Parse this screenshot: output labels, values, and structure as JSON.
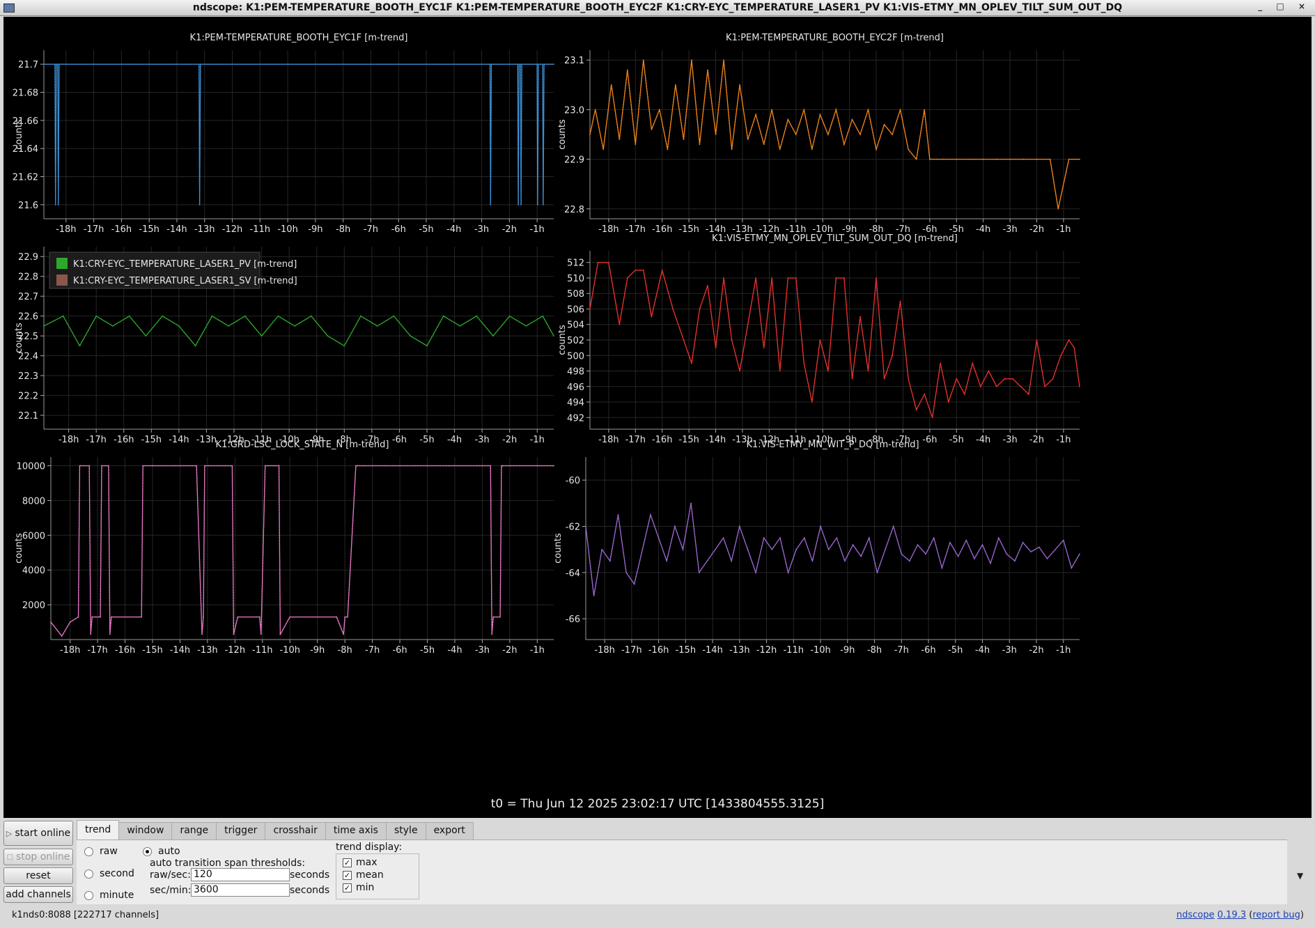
{
  "window": {
    "title": "ndscope: K1:PEM-TEMPERATURE_BOOTH_EYC1F K1:PEM-TEMPERATURE_BOOTH_EYC2F K1:CRY-EYC_TEMPERATURE_LASER1_PV K1:VIS-ETMY_MN_OPLEV_TILT_SUM_OUT_DQ",
    "icon": "app-window-icon",
    "controls": "_ □ ×"
  },
  "plots": {
    "t0": "t0 = Thu Jun 12 2025 23:02:17 UTC [1433804555.3125]"
  },
  "chart_data": [
    {
      "type": "line",
      "title": "K1:PEM-TEMPERATURE_BOOTH_EYC1F [m-trend]",
      "ylabel": "counts",
      "xticks": [
        "-18h",
        "-17h",
        "-16h",
        "-15h",
        "-14h",
        "-13h",
        "-12h",
        "-11h",
        "-10h",
        "-9h",
        "-8h",
        "-7h",
        "-6h",
        "-5h",
        "-4h",
        "-3h",
        "-2h",
        "-1h"
      ],
      "yticks": [
        "21.6",
        "21.62",
        "21.64",
        "21.66",
        "21.68",
        "21.7"
      ],
      "xlim": [
        -18.8,
        -0.4
      ],
      "ylim": [
        21.59,
        21.71
      ],
      "color": "#3b8fd4",
      "series": [
        {
          "x": [
            -18.8,
            -18.4,
            -18.38,
            -18.35,
            -18.3,
            -18.28,
            -18.25,
            -13.2,
            -13.18,
            -13.15,
            -2.7,
            -2.68,
            -2.65,
            -1.7,
            -1.68,
            -1.65,
            -1.6,
            -1.58,
            -1.55,
            -1.0,
            -0.98,
            -0.95,
            -0.8,
            -0.78,
            -0.75,
            -0.6,
            -0.4
          ],
          "y": [
            21.7,
            21.7,
            21.6,
            21.7,
            21.7,
            21.6,
            21.7,
            21.7,
            21.6,
            21.7,
            21.7,
            21.6,
            21.7,
            21.7,
            21.6,
            21.7,
            21.7,
            21.6,
            21.7,
            21.7,
            21.6,
            21.7,
            21.7,
            21.6,
            21.7,
            21.7,
            21.7
          ]
        }
      ]
    },
    {
      "type": "line",
      "title": "K1:PEM-TEMPERATURE_BOOTH_EYC2F [m-trend]",
      "ylabel": "counts",
      "xticks": [
        "-18h",
        "-17h",
        "-16h",
        "-15h",
        "-14h",
        "-13h",
        "-12h",
        "-11h",
        "-10h",
        "-9h",
        "-8h",
        "-7h",
        "-6h",
        "-5h",
        "-4h",
        "-3h",
        "-2h",
        "-1h"
      ],
      "yticks": [
        "22.8",
        "22.9",
        "23.0",
        "23.1"
      ],
      "xlim": [
        -18.7,
        -0.4
      ],
      "ylim": [
        22.78,
        23.12
      ],
      "color": "#f0841a",
      "series": [
        {
          "x": [
            -18.7,
            -18.5,
            -18.2,
            -17.9,
            -17.6,
            -17.3,
            -17.0,
            -16.7,
            -16.4,
            -16.1,
            -15.8,
            -15.5,
            -15.2,
            -14.9,
            -14.6,
            -14.3,
            -14.0,
            -13.7,
            -13.4,
            -13.1,
            -12.8,
            -12.5,
            -12.2,
            -11.9,
            -11.6,
            -11.3,
            -11.0,
            -10.7,
            -10.4,
            -10.1,
            -9.8,
            -9.5,
            -9.2,
            -8.9,
            -8.6,
            -8.3,
            -8.0,
            -7.7,
            -7.4,
            -7.1,
            -6.8,
            -6.5,
            -6.2,
            -6.0,
            -5.5,
            -5.0,
            -4.5,
            -4.0,
            -3.5,
            -3.0,
            -2.5,
            -2.0,
            -1.5,
            -1.2,
            -0.8,
            -0.4
          ],
          "y": [
            22.95,
            23.0,
            22.92,
            23.05,
            22.94,
            23.08,
            22.93,
            23.1,
            22.96,
            23.0,
            22.92,
            23.05,
            22.94,
            23.1,
            22.93,
            23.08,
            22.95,
            23.1,
            22.92,
            23.05,
            22.94,
            22.99,
            22.93,
            23.0,
            22.92,
            22.98,
            22.95,
            23.0,
            22.92,
            22.99,
            22.95,
            23.0,
            22.93,
            22.98,
            22.95,
            23.0,
            22.92,
            22.97,
            22.95,
            23.0,
            22.92,
            22.9,
            23.0,
            22.9,
            22.9,
            22.9,
            22.9,
            22.9,
            22.9,
            22.9,
            22.9,
            22.9,
            22.9,
            22.8,
            22.9,
            22.9
          ]
        }
      ]
    },
    {
      "type": "line",
      "title": "",
      "ylabel": "counts",
      "xticks": [
        "-18h",
        "-17h",
        "-16h",
        "-15h",
        "-14h",
        "-13h",
        "-12h",
        "-11h",
        "-10h",
        "-9h",
        "-8h",
        "-7h",
        "-6h",
        "-5h",
        "-4h",
        "-3h",
        "-2h",
        "-1h"
      ],
      "yticks": [
        "22.1",
        "22.2",
        "22.3",
        "22.4",
        "22.5",
        "22.6",
        "22.7",
        "22.8",
        "22.9"
      ],
      "xlim": [
        -18.9,
        -0.4
      ],
      "ylim": [
        22.03,
        22.95
      ],
      "legend": [
        "K1:CRY-EYC_TEMPERATURE_LASER1_PV [m-trend]",
        "K1:CRY-EYC_TEMPERATURE_LASER1_SV [m-trend]"
      ],
      "legend_colors": [
        "#2ca82c",
        "#8c564b"
      ],
      "color": "#2ca82c",
      "series": [
        {
          "name": "K1:CRY-EYC_TEMPERATURE_LASER1_PV [m-trend]",
          "x": [
            -18.9,
            -18.2,
            -17.6,
            -17.0,
            -16.4,
            -15.8,
            -15.2,
            -14.6,
            -14.0,
            -13.4,
            -12.8,
            -12.2,
            -11.6,
            -11.0,
            -10.4,
            -9.8,
            -9.2,
            -8.6,
            -8.0,
            -7.4,
            -6.8,
            -6.2,
            -5.6,
            -5.0,
            -4.4,
            -3.8,
            -3.2,
            -2.6,
            -2.0,
            -1.4,
            -0.8,
            -0.4
          ],
          "y": [
            22.55,
            22.6,
            22.45,
            22.6,
            22.55,
            22.6,
            22.5,
            22.6,
            22.55,
            22.45,
            22.6,
            22.55,
            22.6,
            22.5,
            22.6,
            22.55,
            22.6,
            22.5,
            22.45,
            22.6,
            22.55,
            22.6,
            22.5,
            22.45,
            22.6,
            22.55,
            22.6,
            22.5,
            22.6,
            22.55,
            22.6,
            22.5
          ]
        }
      ]
    },
    {
      "type": "line",
      "title": "K1:VIS-ETMY_MN_OPLEV_TILT_SUM_OUT_DQ [m-trend]",
      "ylabel": "counts",
      "xticks": [
        "-18h",
        "-17h",
        "-16h",
        "-15h",
        "-14h",
        "-13h",
        "-12h",
        "-11h",
        "-10h",
        "-9h",
        "-8h",
        "-7h",
        "-6h",
        "-5h",
        "-4h",
        "-3h",
        "-2h",
        "-1h"
      ],
      "yticks": [
        "492",
        "494",
        "496",
        "498",
        "500",
        "502",
        "504",
        "506",
        "508",
        "510",
        "512"
      ],
      "xlim": [
        -18.7,
        -0.4
      ],
      "ylim": [
        490.5,
        513.5
      ],
      "color": "#e8322e",
      "series": [
        {
          "x": [
            -18.7,
            -18.4,
            -18.0,
            -17.6,
            -17.3,
            -17.0,
            -16.7,
            -16.4,
            -16.0,
            -15.6,
            -15.2,
            -14.9,
            -14.6,
            -14.3,
            -14.0,
            -13.7,
            -13.4,
            -13.1,
            -12.8,
            -12.5,
            -12.2,
            -11.9,
            -11.6,
            -11.3,
            -11.0,
            -10.7,
            -10.4,
            -10.1,
            -9.8,
            -9.5,
            -9.2,
            -8.9,
            -8.6,
            -8.3,
            -8.0,
            -7.7,
            -7.4,
            -7.1,
            -6.8,
            -6.5,
            -6.2,
            -5.9,
            -5.6,
            -5.3,
            -5.0,
            -4.7,
            -4.4,
            -4.1,
            -3.8,
            -3.5,
            -3.2,
            -2.9,
            -2.6,
            -2.3,
            -2.0,
            -1.7,
            -1.4,
            -1.1,
            -0.8,
            -0.6,
            -0.4
          ],
          "y": [
            506,
            512,
            512,
            504,
            510,
            511,
            511,
            505,
            511,
            506,
            502,
            499,
            506,
            509,
            501,
            510,
            502,
            498,
            504,
            510,
            501,
            510,
            498,
            510,
            510,
            499,
            494,
            502,
            498,
            510,
            510,
            497,
            505,
            498,
            510,
            497,
            500,
            507,
            497,
            493,
            495,
            492,
            499,
            494,
            497,
            495,
            499,
            496,
            498,
            496,
            497,
            497,
            496,
            495,
            502,
            496,
            497,
            500,
            502,
            501,
            496
          ]
        }
      ]
    },
    {
      "type": "line",
      "title": "K1:GRD-LSC_LOCK_STATE_N [m-trend]",
      "ylabel": "counts",
      "xticks": [
        "-18h",
        "-17h",
        "-16h",
        "-15h",
        "-14h",
        "-13h",
        "-12h",
        "-11h",
        "-10h",
        "-9h",
        "-8h",
        "-7h",
        "-6h",
        "-5h",
        "-4h",
        "-3h",
        "-2h",
        "-1h"
      ],
      "yticks": [
        "2000",
        "4000",
        "6000",
        "8000",
        "10000"
      ],
      "xlim": [
        -18.7,
        -0.4
      ],
      "ylim": [
        0,
        10500
      ],
      "color": "#e377c2",
      "series": [
        {
          "x": [
            -18.7,
            -18.3,
            -18.0,
            -17.7,
            -17.65,
            -17.3,
            -17.25,
            -17.2,
            -16.9,
            -16.85,
            -16.6,
            -16.55,
            -16.5,
            -15.4,
            -15.35,
            -15.0,
            -13.4,
            -13.2,
            -13.15,
            -13.1,
            -12.1,
            -12.05,
            -11.9,
            -11.1,
            -11.05,
            -10.9,
            -10.4,
            -10.35,
            -10.0,
            -8.3,
            -8.05,
            -8.0,
            -7.9,
            -7.6,
            -7.55,
            -7.3,
            -2.7,
            -2.65,
            -2.6,
            -2.35,
            -2.3,
            -2.25,
            -0.4
          ],
          "y": [
            1000,
            200,
            1000,
            1300,
            10000,
            10000,
            300,
            1300,
            1300,
            10000,
            10000,
            300,
            1300,
            1300,
            10000,
            10000,
            10000,
            300,
            1300,
            10000,
            10000,
            300,
            1300,
            1300,
            300,
            10000,
            10000,
            300,
            1300,
            1300,
            300,
            1300,
            1300,
            10000,
            10000,
            10000,
            10000,
            300,
            1300,
            1300,
            10000,
            10000,
            10000
          ]
        }
      ]
    },
    {
      "type": "line",
      "title": "K1:VIS-ETMY_MN_WIT_P_DQ [m-trend]",
      "ylabel": "counts",
      "xticks": [
        "-18h",
        "-17h",
        "-16h",
        "-15h",
        "-14h",
        "-13h",
        "-12h",
        "-11h",
        "-10h",
        "-9h",
        "-8h",
        "-7h",
        "-6h",
        "-5h",
        "-4h",
        "-3h",
        "-2h",
        "-1h"
      ],
      "yticks": [
        "-66",
        "-64",
        "-62",
        "-60"
      ],
      "xlim": [
        -18.7,
        -0.4
      ],
      "ylim": [
        -66.9,
        -59.0
      ],
      "color": "#9a67cf",
      "series": [
        {
          "x": [
            -18.7,
            -18.4,
            -18.1,
            -17.8,
            -17.5,
            -17.2,
            -16.9,
            -16.6,
            -16.3,
            -16.0,
            -15.7,
            -15.4,
            -15.1,
            -14.8,
            -14.5,
            -14.2,
            -13.9,
            -13.6,
            -13.3,
            -13.0,
            -12.7,
            -12.4,
            -12.1,
            -11.8,
            -11.5,
            -11.2,
            -10.9,
            -10.6,
            -10.3,
            -10.0,
            -9.7,
            -9.4,
            -9.1,
            -8.8,
            -8.5,
            -8.2,
            -7.9,
            -7.6,
            -7.3,
            -7.0,
            -6.7,
            -6.4,
            -6.1,
            -5.8,
            -5.5,
            -5.2,
            -4.9,
            -4.6,
            -4.3,
            -4.0,
            -3.7,
            -3.4,
            -3.1,
            -2.8,
            -2.5,
            -2.2,
            -1.9,
            -1.6,
            -1.3,
            -1.0,
            -0.7,
            -0.4
          ],
          "y": [
            -62,
            -65,
            -63,
            -63.5,
            -61.5,
            -64,
            -64.5,
            -63,
            -61.5,
            -62.5,
            -63.5,
            -62,
            -63,
            -61,
            -64,
            -63.5,
            -63,
            -62.5,
            -63.5,
            -62,
            -63,
            -64,
            -62.5,
            -63,
            -62.5,
            -64,
            -63,
            -62.5,
            -63.5,
            -62,
            -63,
            -62.5,
            -63.5,
            -62.8,
            -63.3,
            -62.5,
            -64,
            -63,
            -62,
            -63.2,
            -63.5,
            -62.8,
            -63.2,
            -62.5,
            -63.8,
            -62.7,
            -63.3,
            -62.6,
            -63.4,
            -62.8,
            -63.6,
            -62.5,
            -63.2,
            -63.5,
            -62.7,
            -63.1,
            -62.9,
            -63.4,
            -63,
            -62.6,
            -63.8,
            -63.2
          ]
        }
      ]
    }
  ],
  "controls": {
    "start_online": "start online",
    "stop_online": "stop online",
    "reset": "reset",
    "add_channels": "add channels",
    "tabs": [
      "trend",
      "window",
      "range",
      "trigger",
      "crosshair",
      "time axis",
      "style",
      "export"
    ],
    "active_tab": "trend",
    "trend": {
      "raw": "raw",
      "second": "second",
      "minute": "minute",
      "auto": "auto",
      "thresholds_label": "auto transition span thresholds:",
      "raw_sec_label": "raw/sec:",
      "raw_sec_value": "120",
      "sec_min_label": "sec/min:",
      "sec_min_value": "3600",
      "seconds": "seconds",
      "display_label": "trend display:",
      "max": "max",
      "mean": "mean",
      "min": "min"
    }
  },
  "status": {
    "server": "k1nds0:8088  [222717 channels]",
    "app": "ndscope",
    "version": "0.19.3",
    "report_bug": "report bug"
  }
}
